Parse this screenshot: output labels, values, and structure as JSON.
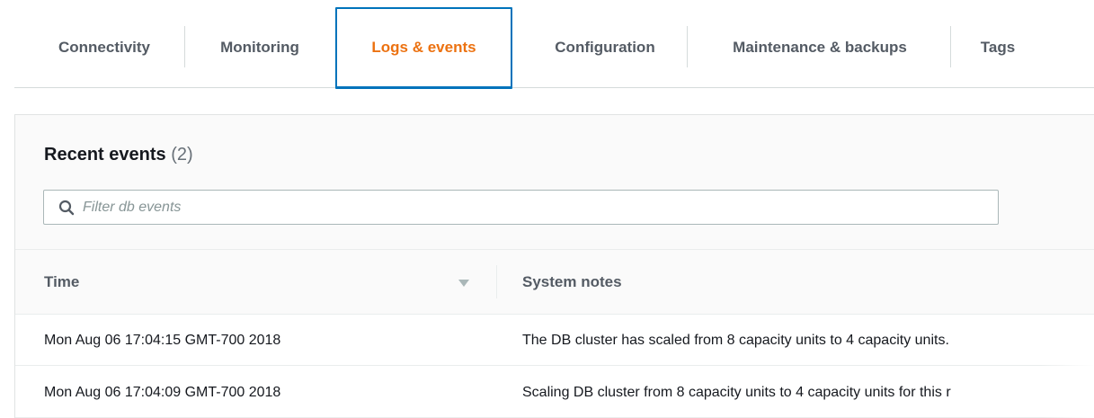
{
  "tabs": [
    {
      "label": "Connectivity",
      "active": false
    },
    {
      "label": "Monitoring",
      "active": false
    },
    {
      "label": "Logs & events",
      "active": true
    },
    {
      "label": "Configuration",
      "active": false
    },
    {
      "label": "Maintenance & backups",
      "active": false
    },
    {
      "label": "Tags",
      "active": false
    }
  ],
  "events": {
    "title": "Recent events",
    "count": "(2)",
    "search": {
      "placeholder": "Filter db events",
      "value": ""
    },
    "columns": {
      "time": "Time",
      "notes": "System notes"
    },
    "rows": [
      {
        "time": "Mon Aug 06 17:04:15 GMT-700 2018",
        "notes": "The DB cluster has scaled from 8 capacity units to 4 capacity units."
      },
      {
        "time": "Mon Aug 06 17:04:09 GMT-700 2018",
        "notes": "Scaling DB cluster from 8 capacity units to 4 capacity units for this r"
      }
    ]
  },
  "colors": {
    "active_tab_text": "#ec7211",
    "active_tab_border": "#0073bb",
    "tab_text": "#545b64"
  },
  "icons": {
    "search": "search-icon",
    "sort": "sort-down-icon"
  }
}
